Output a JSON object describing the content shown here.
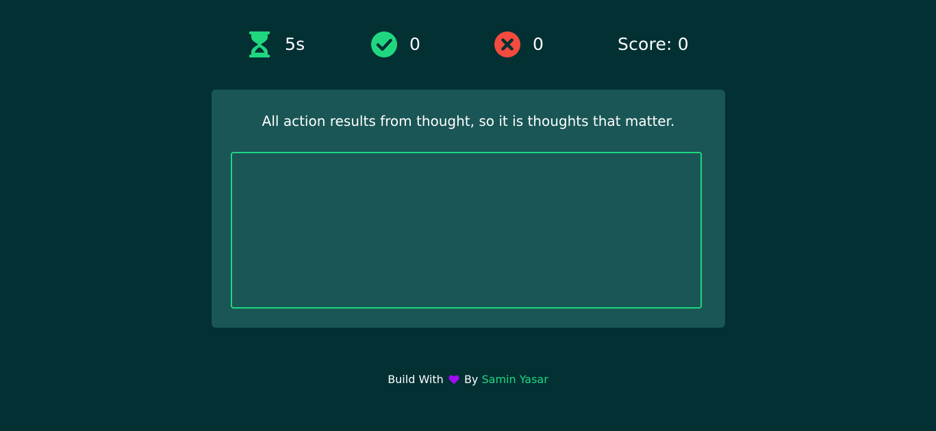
{
  "stats": {
    "timer": "5s",
    "correct": "0",
    "wrong": "0",
    "score": "Score: 0"
  },
  "quote": "All action results from thought, so it is thoughts that matter.",
  "input": {
    "value": ""
  },
  "footer": {
    "prefix": "Build With",
    "by": "By",
    "author": "Samin Yasar"
  },
  "icons": {
    "timer": "hourglass-icon",
    "correct": "check-circle-icon",
    "wrong": "x-circle-icon",
    "heart": "heart-icon"
  },
  "colors": {
    "background": "#023033",
    "card": "#1a5656",
    "accent": "#20d780",
    "error": "#f44b3f",
    "heart": "#a20cf3"
  }
}
